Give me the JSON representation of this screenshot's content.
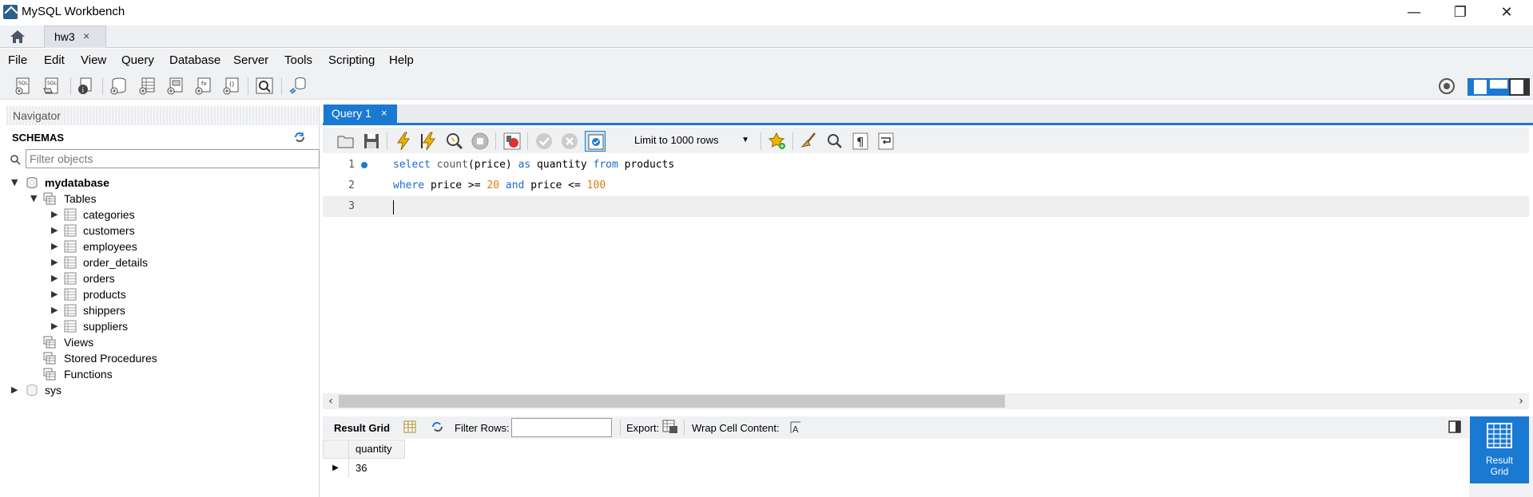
{
  "window": {
    "title": "MySQL Workbench",
    "minimize": "—",
    "maximize": "❐",
    "close": "✕"
  },
  "connection_tab": {
    "label": "hw3",
    "close": "×"
  },
  "menu": {
    "items": [
      "File",
      "Edit",
      "View",
      "Query",
      "Database",
      "Server",
      "Tools",
      "Scripting",
      "Help"
    ]
  },
  "navigator": {
    "header": "Navigator",
    "schemas_label": "SCHEMAS",
    "filter_placeholder": "Filter objects",
    "tree": {
      "schema": "mydatabase",
      "tables_label": "Tables",
      "tables": [
        "categories",
        "customers",
        "employees",
        "order_details",
        "orders",
        "products",
        "shippers",
        "suppliers"
      ],
      "views_label": "Views",
      "procedures_label": "Stored Procedures",
      "functions_label": "Functions",
      "other_schema": "sys"
    }
  },
  "query_tab": {
    "label": "Query 1",
    "close": "×"
  },
  "sql_toolbar": {
    "limit_label": "Limit to 1000 rows"
  },
  "editor": {
    "lines": [
      {
        "num": "1",
        "tokens": [
          {
            "t": "select",
            "c": "kw"
          },
          {
            "t": " "
          },
          {
            "t": "count",
            "c": "fn"
          },
          {
            "t": "(price) "
          },
          {
            "t": "as",
            "c": "kw"
          },
          {
            "t": " quantity "
          },
          {
            "t": "from",
            "c": "kw"
          },
          {
            "t": " products"
          }
        ]
      },
      {
        "num": "2",
        "tokens": [
          {
            "t": "where",
            "c": "kw"
          },
          {
            "t": " price >= "
          },
          {
            "t": "20",
            "c": "num"
          },
          {
            "t": " "
          },
          {
            "t": "and",
            "c": "kw"
          },
          {
            "t": " price <= "
          },
          {
            "t": "100",
            "c": "num"
          }
        ]
      },
      {
        "num": "3",
        "tokens": []
      }
    ],
    "active_line": 3
  },
  "result_toolbar": {
    "result_grid": "Result Grid",
    "filter_rows": "Filter Rows:",
    "export": "Export:",
    "wrap_cell": "Wrap Cell Content:"
  },
  "result": {
    "columns": [
      "quantity"
    ],
    "rows": [
      [
        "36"
      ]
    ]
  },
  "side_panel": {
    "result_grid_label": "Result\nGrid"
  },
  "colors": {
    "accent": "#1a79d1",
    "keyword": "#1a6ad0",
    "number": "#e07a14"
  }
}
